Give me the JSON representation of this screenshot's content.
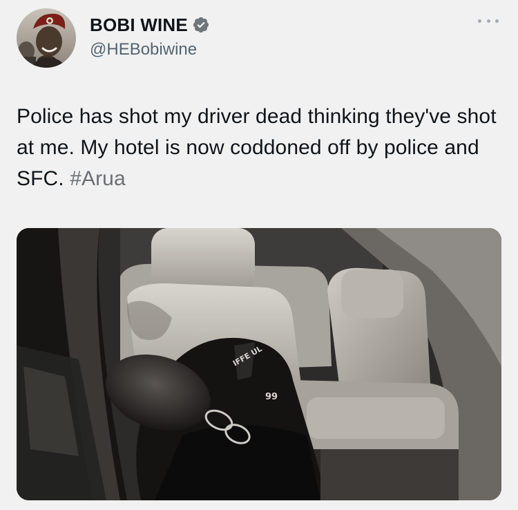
{
  "author": {
    "display_name": "BOBI WINE",
    "handle": "@HEBobiwine",
    "avatar_icon": "profile-photo",
    "verified_icon": "verified-badge-icon",
    "verified_color": "#6f767b"
  },
  "menu": {
    "icon": "more-options-icon"
  },
  "tweet": {
    "text": "Police has shot my driver dead thinking they've shot at me. My hotel is now coddoned off by police and SFC.",
    "hashtag": "#Arua",
    "hashtag_color": "#6a6f74"
  },
  "media": {
    "type": "photo",
    "jersey_number": "99",
    "jersey_text": "IFFE UL"
  }
}
